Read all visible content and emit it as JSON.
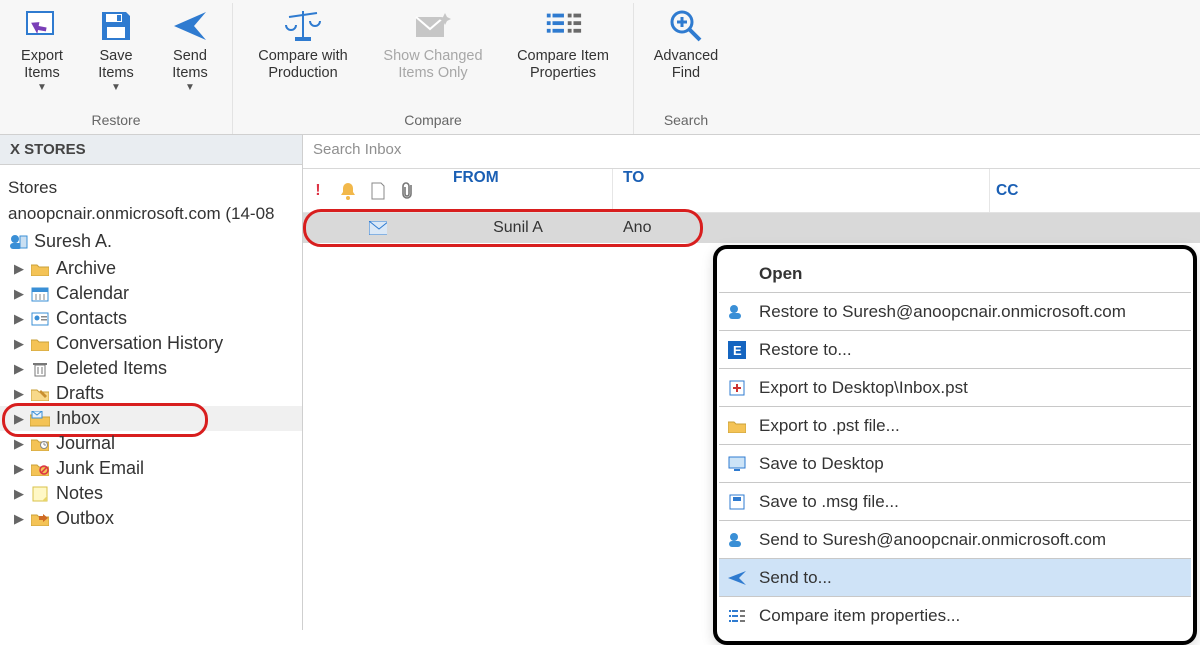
{
  "ribbon": {
    "restore": {
      "title": "Restore",
      "export": "Export\nItems",
      "save": "Save\nItems",
      "send": "Send\nItems"
    },
    "compare": {
      "title": "Compare",
      "with_prod": "Compare with\nProduction",
      "changed": "Show Changed\nItems Only",
      "item_props": "Compare Item\nProperties"
    },
    "search": {
      "title": "Search",
      "advanced": "Advanced\nFind"
    }
  },
  "nav": {
    "header": "X STORES",
    "stores_label": "Stores",
    "account": "anoopcnair.onmicrosoft.com (14-08",
    "user": "Suresh A.",
    "folders": {
      "archive": "Archive",
      "calendar": "Calendar",
      "contacts": "Contacts",
      "conv_hist": "Conversation History",
      "deleted": "Deleted Items",
      "drafts": "Drafts",
      "inbox": "Inbox",
      "journal": "Journal",
      "junk": "Junk Email",
      "notes": "Notes",
      "outbox": "Outbox"
    }
  },
  "list": {
    "search_placeholder": "Search Inbox",
    "cols": {
      "from": "FROM",
      "to": "TO",
      "cc": "CC"
    },
    "row": {
      "from": "Sunil A",
      "to": "Ano"
    }
  },
  "menu": {
    "open": "Open",
    "restore_to_addr": "Restore to Suresh@anoopcnair.onmicrosoft.com",
    "restore_to": "Restore to...",
    "export_path": "Export to Desktop\\Inbox.pst",
    "export_pst": "Export to .pst file...",
    "save_desktop": "Save to Desktop",
    "save_msg": "Save to .msg file...",
    "send_to_addr": "Send to Suresh@anoopcnair.onmicrosoft.com",
    "send_to": "Send to...",
    "compare": "Compare item properties..."
  }
}
